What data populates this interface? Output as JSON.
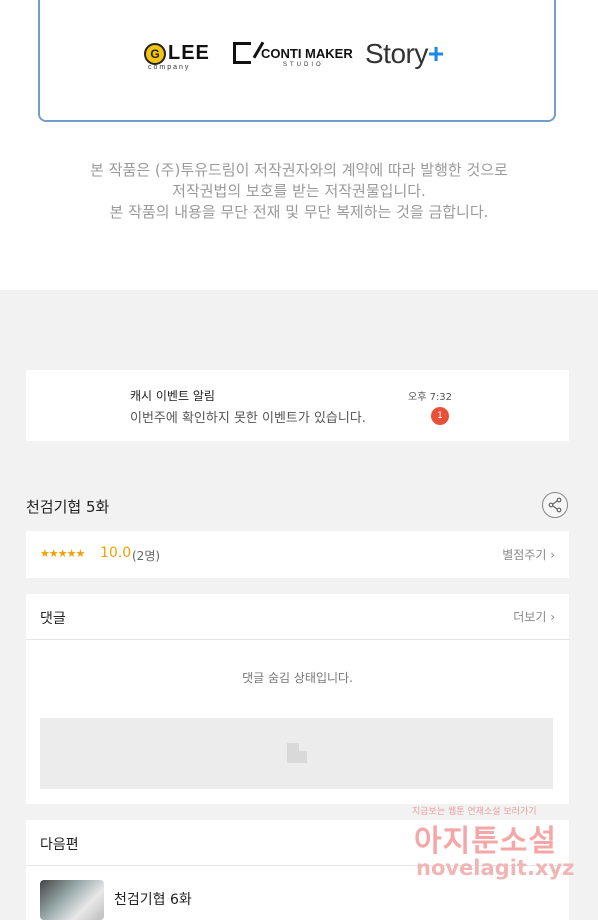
{
  "logos": {
    "glee": "LEE",
    "glee_sub": "company",
    "glee_badge": "G",
    "conti": "CONTI MAKER",
    "conti_sub": "STUDIO",
    "story": "Story",
    "story_plus": "+"
  },
  "notice": {
    "line1": "본 작품은 (주)투유드림이 저작권자와의 계약에 따라 발행한 것으로",
    "line2": "저작권법의 보호를 받는 저작권물입니다.",
    "line3": "본 작품의 내용을 무단 전재 및 무단 복제하는 것을 금합니다."
  },
  "push": {
    "title": "캐시 이벤트 알림",
    "message": "이번주에 확인하지 못한 이벤트가 있습니다.",
    "time": "오후 7:32",
    "badge": "1"
  },
  "episode": {
    "title": "천검기협 5화"
  },
  "rating": {
    "stars": "★★★★★",
    "score": "10.0",
    "count": "(2명)",
    "rate_label": "별점주기 ›"
  },
  "comments": {
    "label": "댓글",
    "more": "더보기 ›",
    "hidden_message": "댓글 숨김 상태입니다."
  },
  "next": {
    "label": "다음편",
    "title": "천검기협 6화"
  },
  "watermark": {
    "top": "지금보는 웹툰 연재소설 보러가기",
    "main": "아지툰소설",
    "url": "novelagit.xyz"
  }
}
